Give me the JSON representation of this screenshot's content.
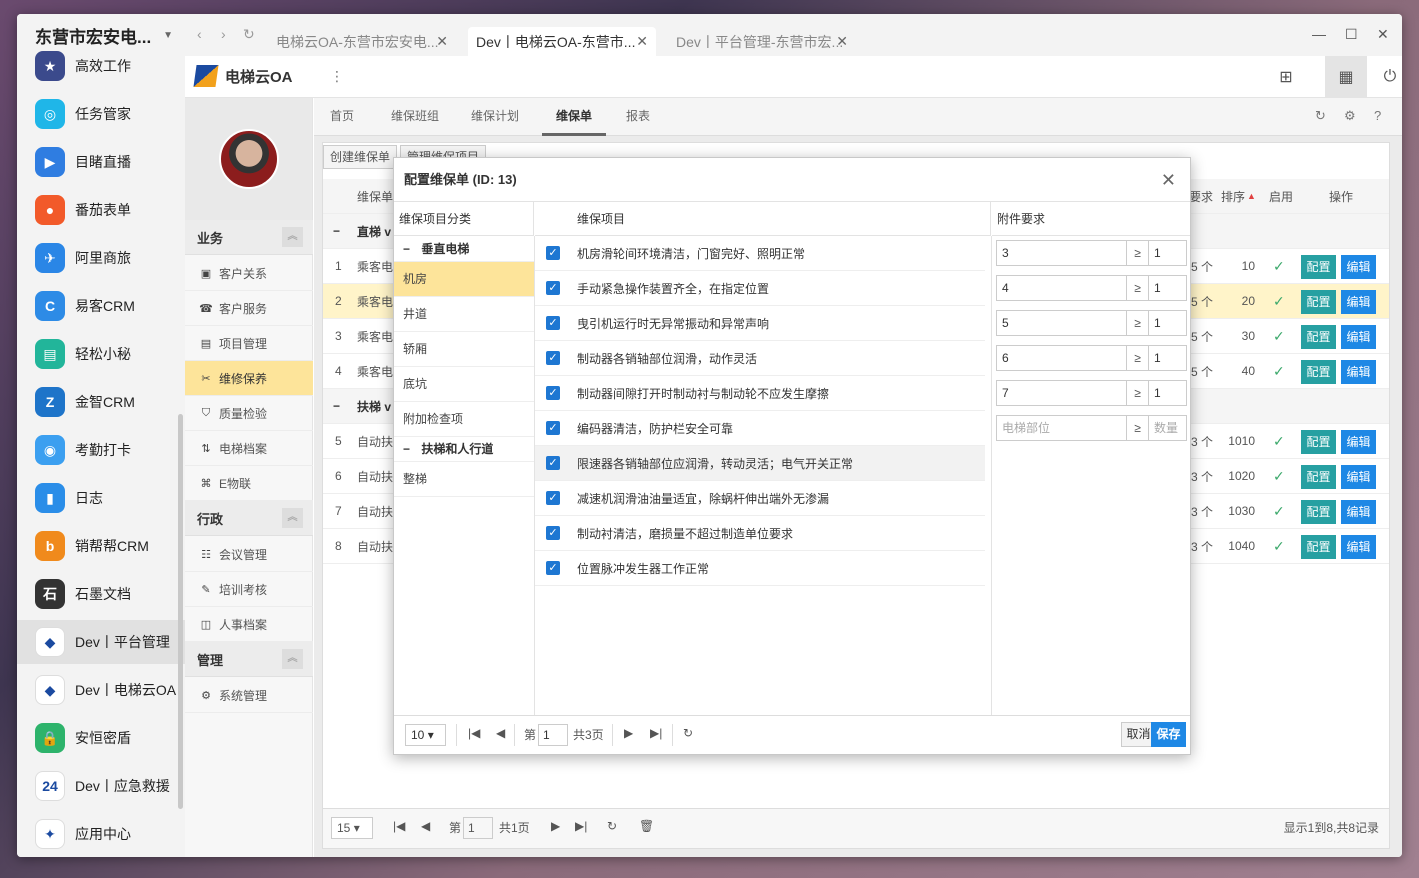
{
  "launcher": {
    "title": "东营市宏安电...",
    "apps": [
      {
        "label": "高效工作",
        "color": "#3b4a8c",
        "glyph": "★"
      },
      {
        "label": "任务管家",
        "color": "#1fb6e8",
        "glyph": "◎"
      },
      {
        "label": "目睹直播",
        "color": "#2f7de1",
        "glyph": "▶"
      },
      {
        "label": "番茄表单",
        "color": "#f25a2a",
        "glyph": "●"
      },
      {
        "label": "阿里商旅",
        "color": "#2a86e6",
        "glyph": "✈"
      },
      {
        "label": "易客CRM",
        "color": "#2d8be6",
        "glyph": "C"
      },
      {
        "label": "轻松小秘",
        "color": "#22b59a",
        "glyph": "▤"
      },
      {
        "label": "金智CRM",
        "color": "#1e74c9",
        "glyph": "Z"
      },
      {
        "label": "考勤打卡",
        "color": "#3b9ff0",
        "glyph": "◉"
      },
      {
        "label": "日志",
        "color": "#2a8de8",
        "glyph": "▮"
      },
      {
        "label": "销帮帮CRM",
        "color": "#f08a1c",
        "glyph": "b"
      },
      {
        "label": "石墨文档",
        "color": "#333333",
        "glyph": "石"
      },
      {
        "label": "Dev丨平台管理",
        "color": "#ffffff",
        "glyph": "◆"
      },
      {
        "label": "Dev丨电梯云OA",
        "color": "#ffffff",
        "glyph": "◆"
      },
      {
        "label": "安恒密盾",
        "color": "#2db36b",
        "glyph": "🔒"
      },
      {
        "label": "Dev丨应急救援",
        "color": "#ffffff",
        "glyph": "24"
      },
      {
        "label": "应用中心",
        "color": "#ffffff",
        "glyph": "✦"
      }
    ]
  },
  "browser_tabs": [
    {
      "label": "电梯云OA-东营市宏安电..."
    },
    {
      "label": "Dev丨电梯云OA-东营市..."
    },
    {
      "label": "Dev丨平台管理-东营市宏..."
    }
  ],
  "app": {
    "name": "电梯云OA"
  },
  "menu": {
    "sections": [
      {
        "title": "业务",
        "items": [
          "客户关系",
          "客户服务",
          "项目管理",
          "维修保养",
          "质量检验",
          "电梯档案",
          "E物联"
        ]
      },
      {
        "title": "行政",
        "items": [
          "会议管理",
          "培训考核",
          "人事档案"
        ]
      },
      {
        "title": "管理",
        "items": [
          "系统管理"
        ]
      }
    ]
  },
  "content_tabs": [
    "首页",
    "维保班组",
    "维保计划",
    "维保单",
    "报表"
  ],
  "toolbar": {
    "create": "创建维保单",
    "manage": "管理维保项目"
  },
  "grid": {
    "headers": {
      "name": "维保单",
      "req": "要求",
      "order": "排序",
      "enabled": "启用",
      "ops": "操作"
    },
    "groups": [
      {
        "title": "直梯 v"
      },
      {
        "title": "扶梯 v"
      }
    ],
    "rows": [
      {
        "no": "1",
        "name": "乘客电",
        "req": "5 个",
        "order": "10"
      },
      {
        "no": "2",
        "name": "乘客电",
        "req": "5 个",
        "order": "20"
      },
      {
        "no": "3",
        "name": "乘客电",
        "req": "5 个",
        "order": "30"
      },
      {
        "no": "4",
        "name": "乘客电",
        "req": "5 个",
        "order": "40"
      },
      {
        "no": "5",
        "name": "自动扶",
        "req": "3 个",
        "order": "1010"
      },
      {
        "no": "6",
        "name": "自动扶",
        "req": "3 个",
        "order": "1020"
      },
      {
        "no": "7",
        "name": "自动扶",
        "req": "3 个",
        "order": "1030"
      },
      {
        "no": "8",
        "name": "自动扶",
        "req": "3 个",
        "order": "1040"
      }
    ],
    "btn_config": "配置",
    "btn_edit": "编辑",
    "pager": {
      "page_size": "15",
      "page_label": "第",
      "page": "1",
      "total_pages": "共1页",
      "summary": "显示1到8,共8记录"
    }
  },
  "dialog": {
    "title": "配置维保单 (ID: 13)",
    "col_category": "维保项目分类",
    "col_item": "维保项目",
    "col_attachment": "附件要求",
    "categories": [
      {
        "label": "垂直电梯",
        "group": true
      },
      {
        "label": "机房"
      },
      {
        "label": "井道"
      },
      {
        "label": "轿厢"
      },
      {
        "label": "底坑"
      },
      {
        "label": "附加检查项"
      },
      {
        "label": "扶梯和人行道",
        "group": true
      },
      {
        "label": "整梯"
      }
    ],
    "items": [
      "机房滑轮间环境清洁，门窗完好、照明正常",
      "手动紧急操作装置齐全，在指定位置",
      "曳引机运行时无异常振动和异常声响",
      "制动器各销轴部位润滑，动作灵活",
      "制动器间隙打开时制动衬与制动轮不应发生摩擦",
      "编码器清洁，防护栏安全可靠",
      "限速器各销轴部位应润滑，转动灵活；电气开关正常",
      "减速机润滑油油量适宜，除蜗杆伸出端外无渗漏",
      "制动衬清洁，磨损量不超过制造单位要求",
      "位置脉冲发生器工作正常"
    ],
    "attachments": [
      {
        "part": "3",
        "qty": "1"
      },
      {
        "part": "4",
        "qty": "1"
      },
      {
        "part": "5",
        "qty": "1"
      },
      {
        "part": "6",
        "qty": "1"
      },
      {
        "part": "7",
        "qty": "1"
      }
    ],
    "attachment_placeholder": {
      "part": "电梯部位",
      "qty": "数量"
    },
    "ge": "≥",
    "pager": {
      "page_size": "10",
      "page_label": "第",
      "page": "1",
      "total_pages": "共3页"
    },
    "cancel": "取消",
    "save": "保存"
  }
}
